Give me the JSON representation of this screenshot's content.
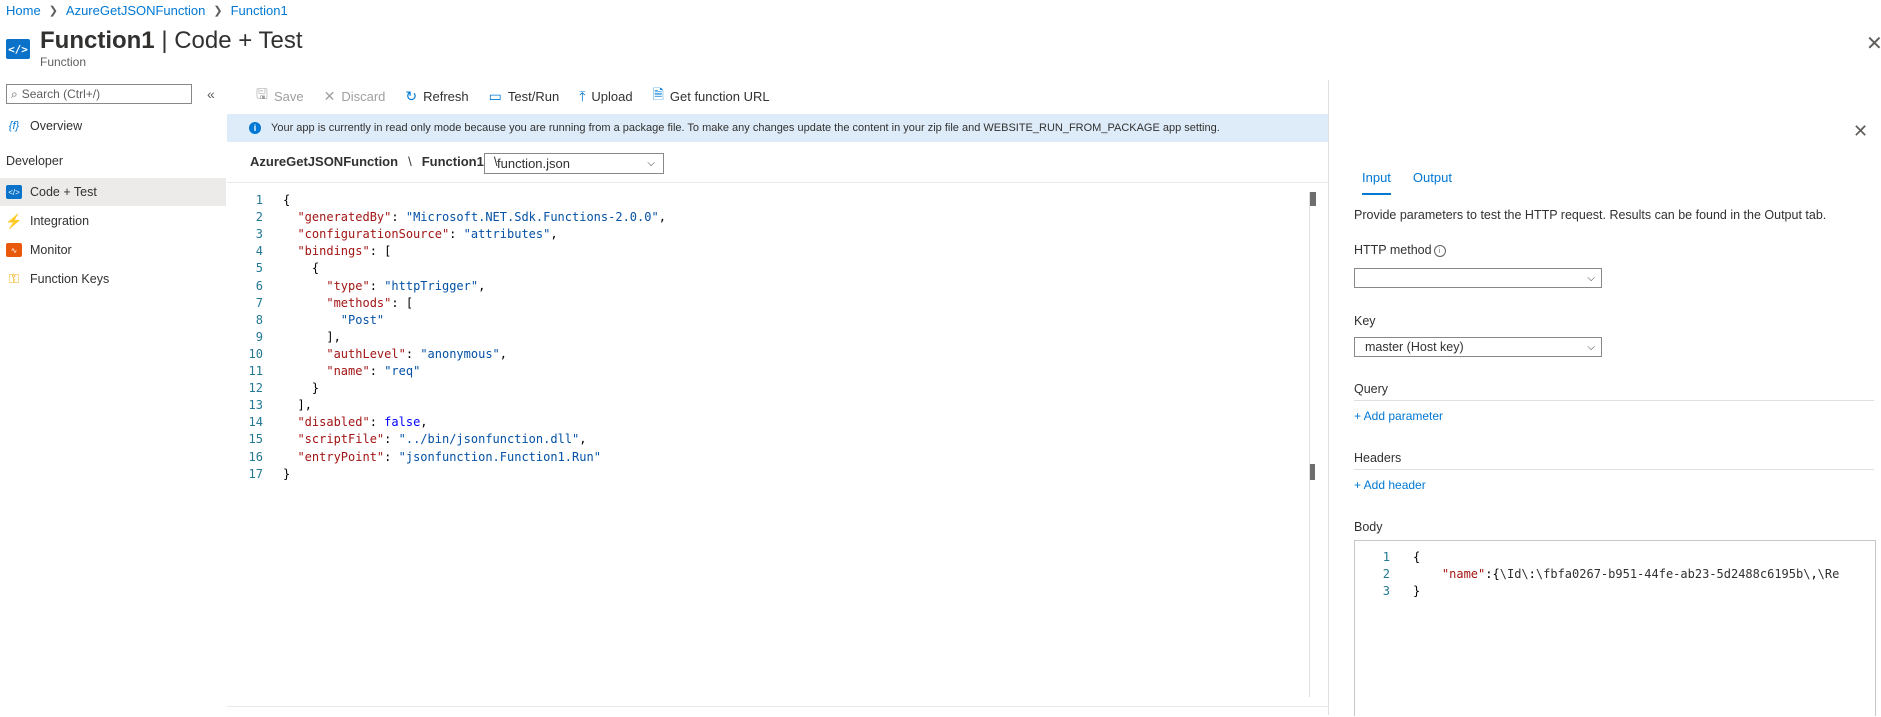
{
  "breadcrumb": [
    "Home",
    "AzureGetJSONFunction",
    "Function1"
  ],
  "header": {
    "title_main": "Function1",
    "title_rest": " | Code + Test",
    "subtitle": "Function",
    "more": "···"
  },
  "sidebar": {
    "search_placeholder": "Search (Ctrl+/)",
    "overview": "Overview",
    "section": "Developer",
    "items": [
      {
        "label": "Code + Test",
        "icon": "code-icon",
        "active": true
      },
      {
        "label": "Integration",
        "icon": "lightning-icon"
      },
      {
        "label": "Monitor",
        "icon": "monitor-icon"
      },
      {
        "label": "Function Keys",
        "icon": "key-icon"
      }
    ]
  },
  "toolbar": {
    "save": "Save",
    "discard": "Discard",
    "refresh": "Refresh",
    "test_run": "Test/Run",
    "upload": "Upload",
    "get_url": "Get function URL"
  },
  "infobar": {
    "message": "Your app is currently in read only mode because you are running from a package file. To make any changes update the content in your zip file and WEBSITE_RUN_FROM_PACKAGE app setting."
  },
  "filepath": {
    "app": "AzureGetJSONFunction",
    "func": "Function1",
    "sep": "\\",
    "file": "function.json"
  },
  "code": [
    "{",
    "  \"generatedBy\": \"Microsoft.NET.Sdk.Functions-2.0.0\",",
    "  \"configurationSource\": \"attributes\",",
    "  \"bindings\": [",
    "    {",
    "      \"type\": \"httpTrigger\",",
    "      \"methods\": [",
    "        \"Post\"",
    "      ],",
    "      \"authLevel\": \"anonymous\",",
    "      \"name\": \"req\"",
    "    }",
    "  ],",
    "  \"disabled\": false,",
    "  \"scriptFile\": \"../bin/jsonfunction.dll\",",
    "  \"entryPoint\": \"jsonfunction.Function1.Run\"",
    "}"
  ],
  "panel": {
    "tabs": [
      "Input",
      "Output"
    ],
    "description": "Provide parameters to test the HTTP request. Results can be found in the Output tab.",
    "http_method_label": "HTTP method",
    "http_method_value": "",
    "key_label": "Key",
    "key_value": "master (Host key)",
    "query_label": "Query",
    "add_parameter": "+ Add parameter",
    "headers_label": "Headers",
    "add_header": "+ Add header",
    "body_label": "Body",
    "body_code": [
      "{",
      "    \"name\":\"{\\\"Id\\\":\\\"fbfa0267-b951-44fe-ab23-5d2488c6195b\\\",\\\"Re",
      "}"
    ]
  },
  "colors": {
    "accent": "#0078d4",
    "info_bg": "#deecf9",
    "json_key": "#a31515",
    "json_string": "#0451a5"
  }
}
